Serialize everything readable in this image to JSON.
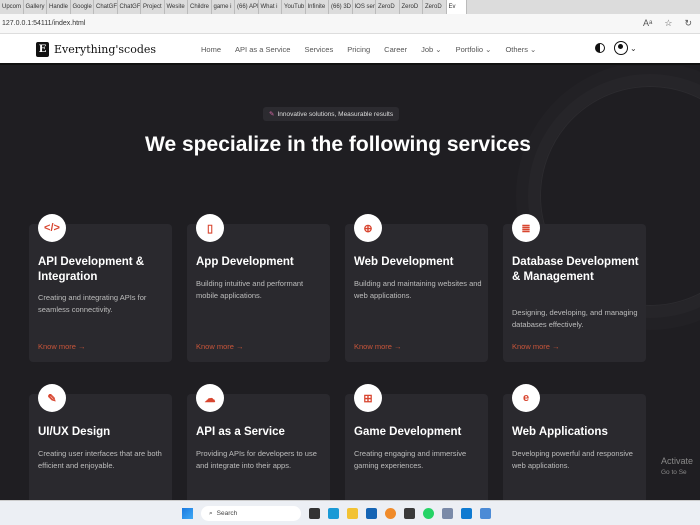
{
  "browser": {
    "tabs": [
      "Upcom",
      "Gallery",
      "Handle",
      "Google",
      "ChatGF",
      "ChatGF",
      "Project",
      "Wesite",
      "Childre",
      "game i",
      "(66) API",
      "What i",
      "YouTub",
      "Infinite",
      "(66) 3D",
      "IOS ser",
      "ZeroD",
      "ZeroD",
      "ZeroD",
      "Ev"
    ],
    "url": "127.0.0.1:54111/index.html"
  },
  "nav": {
    "brand": "Everything'scodes",
    "logo_letter": "E",
    "items": [
      "Home",
      "API as a Service",
      "Services",
      "Pricing",
      "Career",
      "Job ⌄",
      "Portfolio ⌄",
      "Others ⌄"
    ],
    "caret": "⌄"
  },
  "hero": {
    "badge": "Innovative solutions, Measurable results",
    "title": "We specialize in the following services"
  },
  "services": [
    {
      "icon": "code-icon",
      "glyph": "</>",
      "title": "API Development & Integration",
      "desc": "Creating and integrating APIs for seamless connectivity.",
      "link": "Know more →"
    },
    {
      "icon": "mobile-icon",
      "glyph": "▯",
      "title": "App Development",
      "desc": "Building intuitive and performant mobile applications.",
      "link": "Know more →"
    },
    {
      "icon": "globe-icon",
      "glyph": "⊕",
      "title": "Web Development",
      "desc": "Building and maintaining websites and web applications.",
      "link": "Know more →"
    },
    {
      "icon": "database-icon",
      "glyph": "≣",
      "title": "Database Development & Management",
      "desc": "Designing, developing, and managing databases effectively.",
      "link": "Know more →"
    },
    {
      "icon": "pen-icon",
      "glyph": "✎",
      "title": "UI/UX Design",
      "desc": "Creating user interfaces that are both efficient and enjoyable.",
      "link": "Know more →"
    },
    {
      "icon": "cloud-upload-icon",
      "glyph": "☁",
      "title": "API as a Service",
      "desc": "Providing APIs for developers to use and integrate into their apps.",
      "link": "Know more →"
    },
    {
      "icon": "gamepad-icon",
      "glyph": "⊞",
      "title": "Game Development",
      "desc": "Creating engaging and immersive gaming experiences.",
      "link": "Know more →"
    },
    {
      "icon": "web-app-icon",
      "glyph": "e",
      "title": "Web Applications",
      "desc": "Developing powerful and responsive web applications.",
      "link": "Know more →"
    }
  ],
  "watermark": {
    "title": "Activate",
    "sub": "Go to Se"
  },
  "taskbar": {
    "search": "Search"
  },
  "colors": {
    "accent": "#d8452f",
    "bg": "#1f1e22",
    "card": "#2a292e"
  }
}
